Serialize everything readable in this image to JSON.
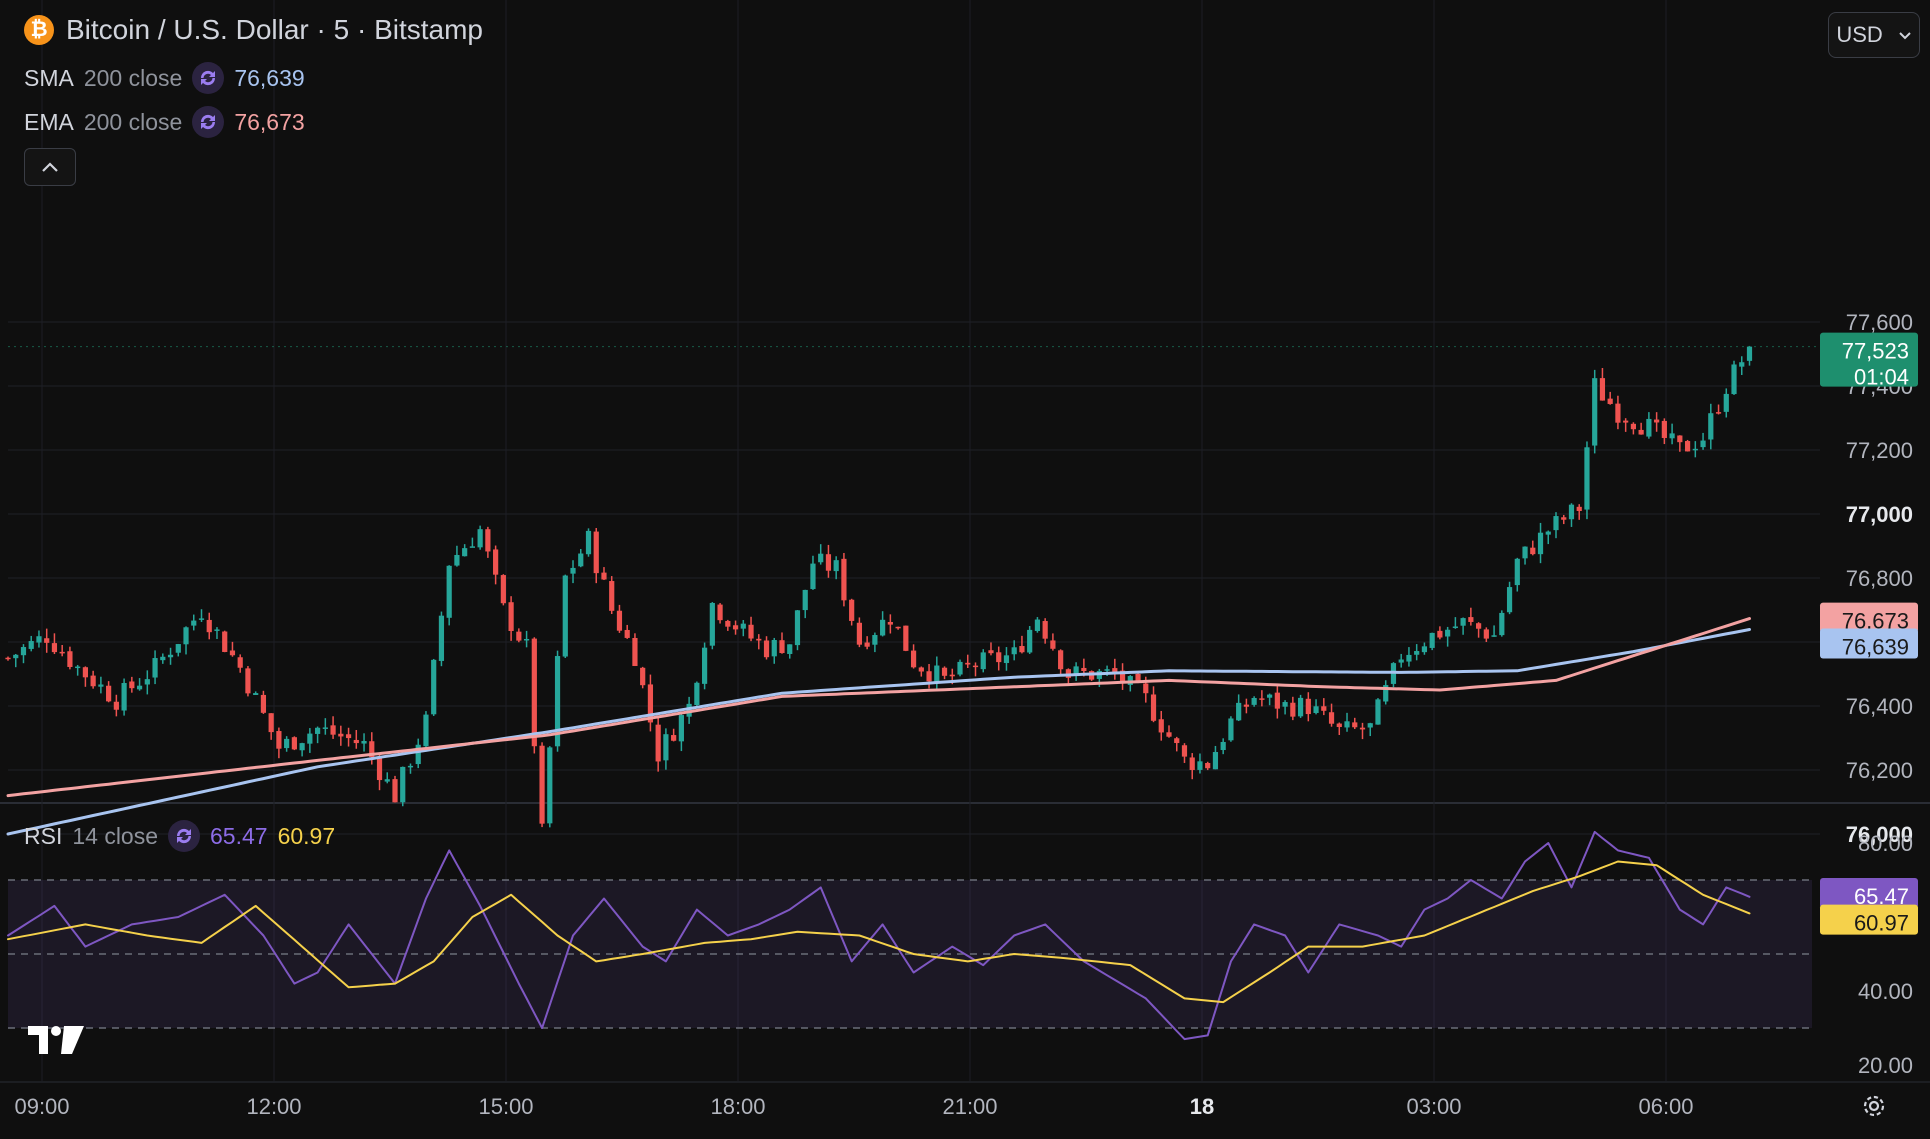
{
  "header": {
    "symbol_title": "Bitcoin / U.S. Dollar · 5 · Bitstamp",
    "coin_glyph": "₿",
    "currency_label": "USD"
  },
  "legend": {
    "sma": {
      "name": "SMA",
      "params": "200 close",
      "value": "76,639"
    },
    "ema": {
      "name": "EMA",
      "params": "200 close",
      "value": "76,673"
    },
    "rsi": {
      "name": "RSI",
      "params": "14 close",
      "value": "65.47",
      "ma_value": "60.97"
    }
  },
  "price_tags": {
    "last": {
      "price": "77,523",
      "countdown": "01:04"
    },
    "ema": "76,673",
    "sma": "76,639",
    "rsi": "65.47",
    "rsi_ma": "60.97"
  },
  "colors": {
    "background": "#0f0f0f",
    "up": "#26a69a",
    "down": "#ef5350",
    "sma": "#a8c4f0",
    "ema": "#f3a2a2",
    "rsi": "#7e57c2",
    "rsi_ma": "#f5d14b",
    "last_tag": "#1e8f6e"
  },
  "icons": {
    "coin": "bitcoin-icon",
    "cycle": "cycle-icon",
    "collapse": "chevron-up-icon",
    "currency_dropdown": "chevron-down-icon",
    "settings": "gear-icon",
    "brand": "tradingview-logo-icon"
  },
  "chart_data": [
    {
      "type": "candlestick",
      "title": "Bitcoin / U.S. Dollar · 5 · Bitstamp",
      "xlabel": "",
      "ylabel": "",
      "x_ticks": [
        "09:00",
        "12:00",
        "15:00",
        "18:00",
        "21:00",
        "18",
        "03:00",
        "06:00"
      ],
      "y_ticks": [
        "77,600",
        "77,400",
        "77,200",
        "77,000",
        "76,800",
        "76,600",
        "76,400",
        "76,200",
        "76,000"
      ],
      "ylim": [
        75800,
        77700
      ],
      "grid": true,
      "anchors": [
        [
          0,
          76550
        ],
        [
          5,
          76620
        ],
        [
          9,
          76520
        ],
        [
          14,
          76420
        ],
        [
          19,
          76520
        ],
        [
          25,
          76700
        ],
        [
          30,
          76520
        ],
        [
          35,
          76270
        ],
        [
          40,
          76330
        ],
        [
          46,
          76280
        ],
        [
          50,
          76120
        ],
        [
          54,
          76350
        ],
        [
          57,
          76850
        ],
        [
          61,
          76950
        ],
        [
          64,
          76700
        ],
        [
          67,
          76580
        ],
        [
          69,
          76000
        ],
        [
          72,
          76800
        ],
        [
          75,
          76920
        ],
        [
          78,
          76700
        ],
        [
          81,
          76560
        ],
        [
          84,
          76250
        ],
        [
          88,
          76400
        ],
        [
          91,
          76720
        ],
        [
          95,
          76630
        ],
        [
          98,
          76580
        ],
        [
          101,
          76600
        ],
        [
          104,
          76850
        ],
        [
          107,
          76830
        ],
        [
          110,
          76600
        ],
        [
          114,
          76680
        ],
        [
          117,
          76540
        ],
        [
          121,
          76480
        ],
        [
          125,
          76530
        ],
        [
          130,
          76560
        ],
        [
          133,
          76680
        ],
        [
          137,
          76500
        ],
        [
          140,
          76500
        ],
        [
          143,
          76500
        ],
        [
          147,
          76420
        ],
        [
          152,
          76230
        ],
        [
          155,
          76220
        ],
        [
          158,
          76350
        ],
        [
          161,
          76430
        ],
        [
          165,
          76400
        ],
        [
          168,
          76400
        ],
        [
          172,
          76320
        ],
        [
          176,
          76330
        ],
        [
          180,
          76560
        ],
        [
          184,
          76620
        ],
        [
          188,
          76660
        ],
        [
          192,
          76620
        ],
        [
          195,
          76850
        ],
        [
          199,
          76950
        ],
        [
          203,
          77020
        ],
        [
          205,
          77400
        ],
        [
          208,
          77320
        ],
        [
          212,
          77270
        ],
        [
          216,
          77200
        ],
        [
          219,
          77240
        ],
        [
          222,
          77400
        ],
        [
          225,
          77520
        ]
      ],
      "last_price": 77523,
      "series": [
        {
          "name": "SMA",
          "values": [
            [
              0,
              76000
            ],
            [
              40,
              76210
            ],
            [
              70,
              76320
            ],
            [
              100,
              76440
            ],
            [
              130,
              76490
            ],
            [
              150,
              76510
            ],
            [
              180,
              76505
            ],
            [
              195,
              76510
            ],
            [
              210,
              76570
            ],
            [
              225,
              76639
            ]
          ]
        },
        {
          "name": "EMA",
          "values": [
            [
              0,
              76120
            ],
            [
              40,
              76230
            ],
            [
              70,
              76310
            ],
            [
              100,
              76430
            ],
            [
              130,
              76460
            ],
            [
              150,
              76480
            ],
            [
              170,
              76460
            ],
            [
              185,
              76450
            ],
            [
              200,
              76480
            ],
            [
              225,
              76673
            ]
          ]
        }
      ]
    },
    {
      "type": "line",
      "title": "RSI 14 close",
      "x_ticks": [
        "09:00",
        "12:00",
        "15:00",
        "18:00",
        "21:00",
        "18",
        "03:00",
        "06:00"
      ],
      "y_ticks": [
        "80.00",
        "60.00",
        "40.00",
        "20.00"
      ],
      "ylim": [
        20,
        90
      ],
      "bands": [
        30,
        50,
        70
      ],
      "grid": true,
      "series": [
        {
          "name": "RSI",
          "values": [
            [
              0,
              55
            ],
            [
              6,
              63
            ],
            [
              10,
              52
            ],
            [
              16,
              58
            ],
            [
              22,
              60
            ],
            [
              28,
              66
            ],
            [
              33,
              55
            ],
            [
              37,
              42
            ],
            [
              40,
              45
            ],
            [
              44,
              58
            ],
            [
              50,
              42
            ],
            [
              54,
              65
            ],
            [
              57,
              78
            ],
            [
              61,
              63
            ],
            [
              66,
              42
            ],
            [
              69,
              30
            ],
            [
              73,
              55
            ],
            [
              77,
              65
            ],
            [
              82,
              52
            ],
            [
              85,
              48
            ],
            [
              89,
              62
            ],
            [
              93,
              55
            ],
            [
              97,
              58
            ],
            [
              101,
              62
            ],
            [
              105,
              68
            ],
            [
              109,
              48
            ],
            [
              113,
              58
            ],
            [
              117,
              45
            ],
            [
              122,
              52
            ],
            [
              126,
              47
            ],
            [
              130,
              55
            ],
            [
              134,
              58
            ],
            [
              139,
              48
            ],
            [
              143,
              43
            ],
            [
              147,
              38
            ],
            [
              152,
              27
            ],
            [
              155,
              28
            ],
            [
              158,
              48
            ],
            [
              161,
              58
            ],
            [
              165,
              55
            ],
            [
              168,
              45
            ],
            [
              172,
              58
            ],
            [
              177,
              55
            ],
            [
              180,
              52
            ],
            [
              183,
              62
            ],
            [
              186,
              65
            ],
            [
              189,
              70
            ],
            [
              193,
              65
            ],
            [
              196,
              75
            ],
            [
              199,
              80
            ],
            [
              202,
              68
            ],
            [
              205,
              83
            ],
            [
              208,
              78
            ],
            [
              212,
              76
            ],
            [
              216,
              62
            ],
            [
              219,
              58
            ],
            [
              222,
              68
            ],
            [
              225,
              65.47
            ]
          ]
        },
        {
          "name": "RSI MA",
          "values": [
            [
              0,
              54
            ],
            [
              10,
              58
            ],
            [
              18,
              55
            ],
            [
              25,
              53
            ],
            [
              32,
              63
            ],
            [
              38,
              52
            ],
            [
              44,
              41
            ],
            [
              50,
              42
            ],
            [
              55,
              48
            ],
            [
              60,
              60
            ],
            [
              65,
              66
            ],
            [
              71,
              55
            ],
            [
              76,
              48
            ],
            [
              82,
              50
            ],
            [
              90,
              53
            ],
            [
              96,
              54
            ],
            [
              102,
              56
            ],
            [
              110,
              55
            ],
            [
              117,
              50
            ],
            [
              124,
              48
            ],
            [
              130,
              50
            ],
            [
              136,
              49
            ],
            [
              145,
              47
            ],
            [
              152,
              38
            ],
            [
              157,
              37
            ],
            [
              163,
              45
            ],
            [
              168,
              52
            ],
            [
              175,
              52
            ],
            [
              183,
              55
            ],
            [
              190,
              61
            ],
            [
              197,
              67
            ],
            [
              203,
              71
            ],
            [
              208,
              75
            ],
            [
              213,
              74
            ],
            [
              219,
              66
            ],
            [
              225,
              60.97
            ]
          ]
        }
      ]
    }
  ]
}
